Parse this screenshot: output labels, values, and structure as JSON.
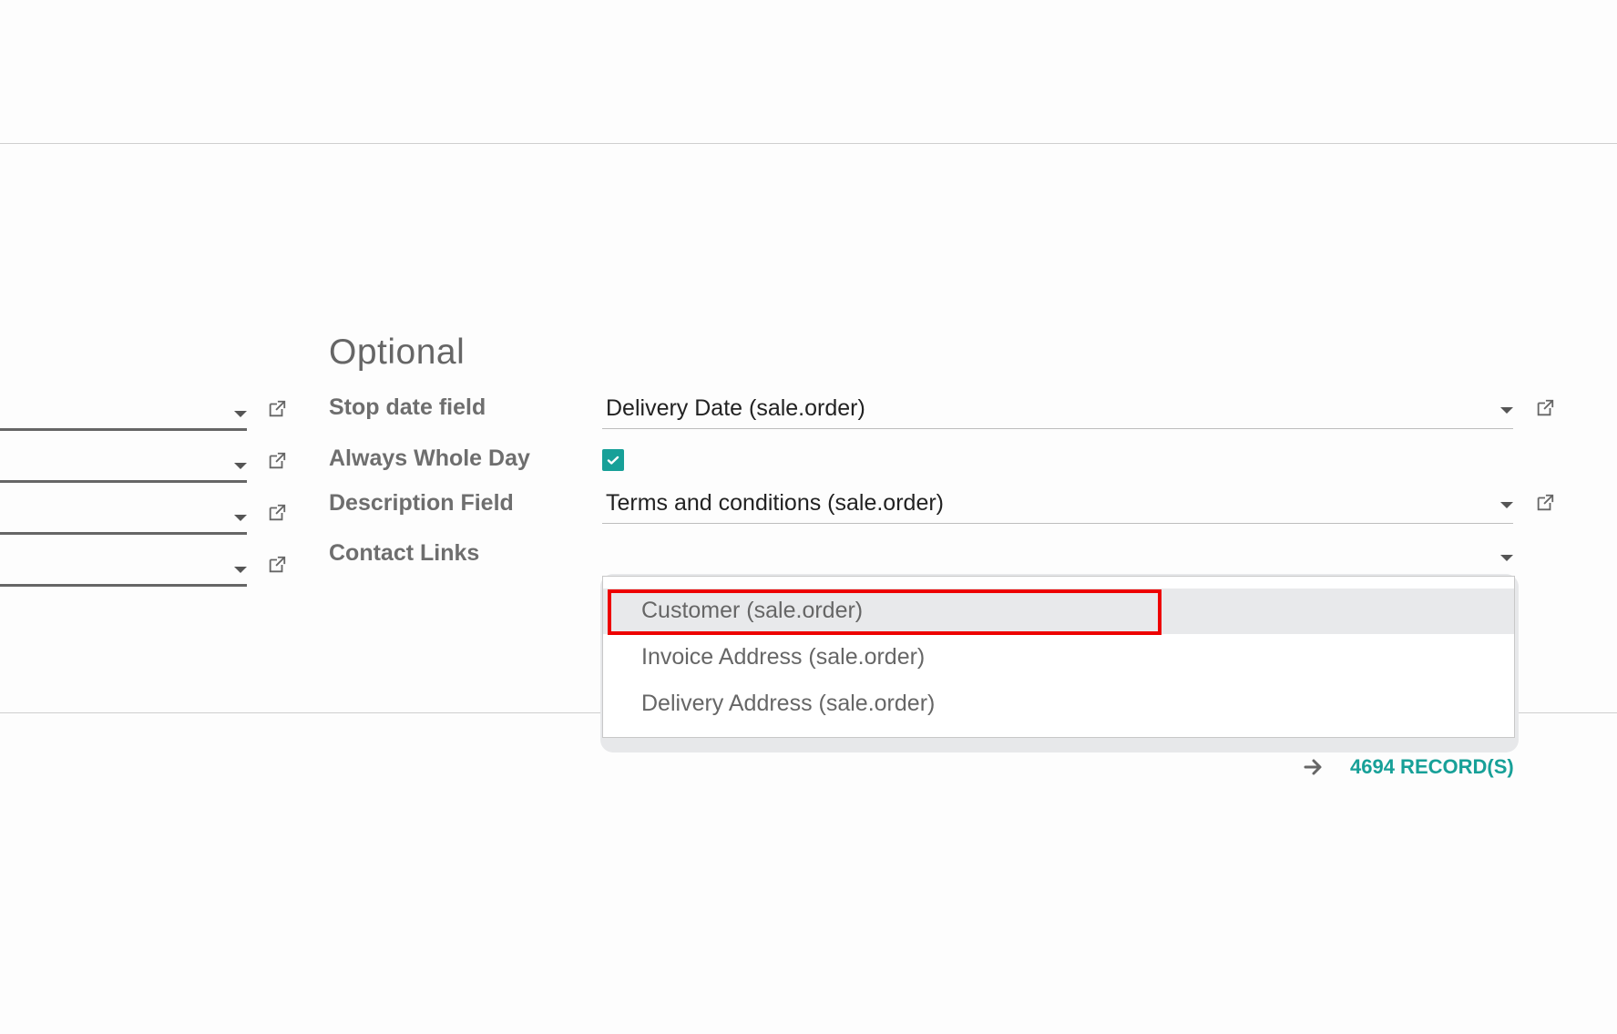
{
  "section": {
    "title": "Optional"
  },
  "fields": {
    "stop_date": {
      "label": "Stop date field",
      "value": "Delivery Date (sale.order)"
    },
    "always_whole_day": {
      "label": "Always Whole Day",
      "checked": true
    },
    "description": {
      "label": "Description Field",
      "value": "Terms and conditions (sale.order)"
    },
    "contact_links": {
      "label": "Contact Links",
      "value": ""
    }
  },
  "dropdown": {
    "items": [
      {
        "label": "Customer (sale.order)",
        "active": true
      },
      {
        "label": "Invoice Address (sale.order)",
        "active": false
      },
      {
        "label": "Delivery Address (sale.order)",
        "active": false
      }
    ]
  },
  "footer": {
    "records_label": "4694 RECORD(S)"
  },
  "colors": {
    "accent": "#17a098",
    "highlight": "#ee0000"
  },
  "icons": {
    "external_link": "external-link-icon",
    "caret": "caret-down-icon",
    "arrow": "arrow-right-icon",
    "check": "check-icon"
  }
}
